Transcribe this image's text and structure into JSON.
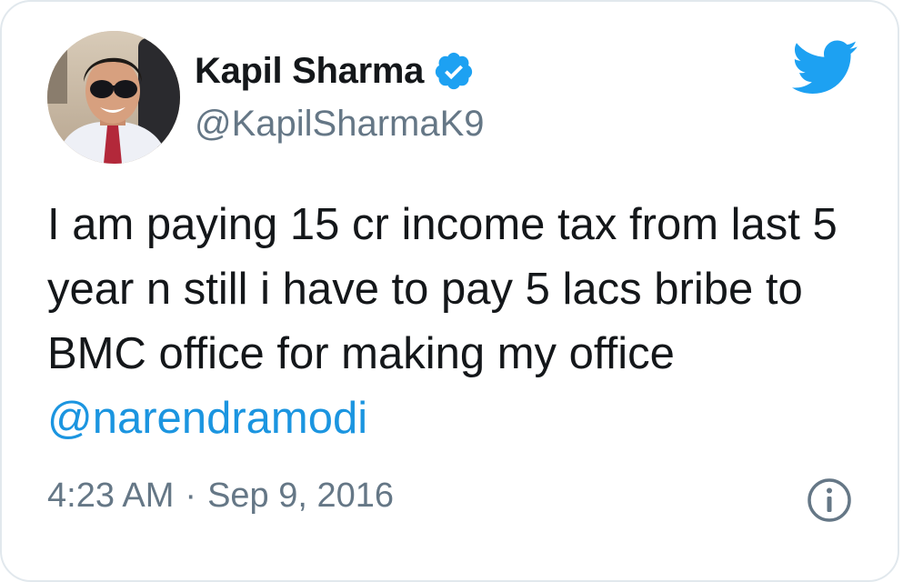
{
  "author": {
    "name": "Kapil Sharma",
    "handle": "@KapilSharmaK9",
    "verified": true
  },
  "tweet": {
    "text": "I am paying 15 cr income tax from last 5 year n still i have to pay 5 lacs bribe to BMC office for making my office ",
    "mention": "@narendramodi"
  },
  "meta": {
    "time": "4:23 AM",
    "separator": "·",
    "date": "Sep 9, 2016"
  },
  "icons": {
    "logo": "twitter-bird-icon",
    "verified": "verified-badge-icon",
    "info": "info-icon"
  },
  "colors": {
    "twitter_blue": "#1da1f2",
    "link_blue": "#1b95e0",
    "text": "#14171a",
    "muted": "#657786",
    "border": "#e1e8ed"
  }
}
